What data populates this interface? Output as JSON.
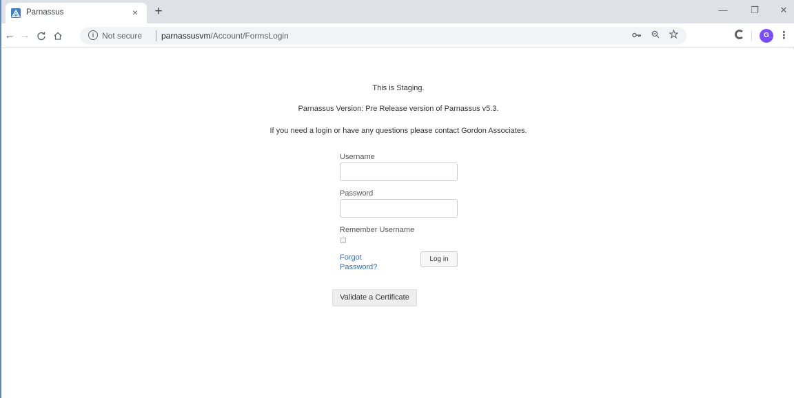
{
  "browser": {
    "tab": {
      "title": "Parnassus",
      "close_glyph": "×"
    },
    "new_tab_glyph": "+",
    "window_controls": {
      "minimize": "—",
      "maximize": "❐",
      "close": "✕"
    },
    "nav": {
      "back": "←",
      "forward": "→",
      "reload": "C",
      "home": "⌂"
    },
    "omnibox": {
      "info_glyph": "i",
      "security_text": "Not secure",
      "host": "parnassusvm",
      "path": "/Account/FormsLogin"
    },
    "toolbar_icons": [
      "key-icon",
      "zoom-icon",
      "star-icon"
    ],
    "avatar_initial": "G",
    "menu_glyph": "⋮"
  },
  "page": {
    "message_staging": "This is Staging.",
    "message_version": "Parnassus Version: Pre Release version of Parnassus v5.3.",
    "message_contact": "If you need a login or have any questions please contact Gordon Associates.",
    "form": {
      "username_label": "Username",
      "username_value": "",
      "password_label": "Password",
      "password_value": "",
      "remember_label": "Remember Username",
      "forgot_label": "Forgot Password?",
      "login_label": "Log in"
    },
    "validate_label": "Validate a Certificate"
  },
  "colors": {
    "link": "#3a6fb0",
    "avatar": "#7c4dff",
    "window_border": "#5b86c8"
  }
}
